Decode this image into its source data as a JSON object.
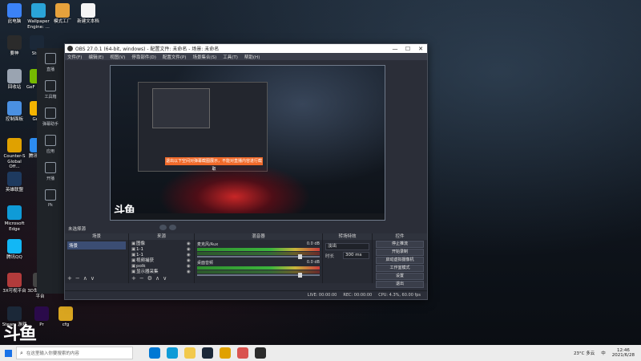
{
  "desktop": {
    "icons": [
      {
        "label": "此电脑",
        "color": "#3b82f6"
      },
      {
        "label": "Wallpaper Engine: ...",
        "color": "#2aa4d8"
      },
      {
        "label": "模式工厂",
        "color": "#e6a23c"
      },
      {
        "label": "新建文本档",
        "color": "#f5f5f5"
      },
      {
        "label": "要神",
        "color": "#2b2b2b"
      },
      {
        "label": "Stea",
        "color": "#1b2838"
      },
      {
        "label": "回收站",
        "color": "#9aa4b1"
      },
      {
        "label": "GeF Expe",
        "color": "#76b900"
      },
      {
        "label": "控制面板",
        "color": "#4a90e2"
      },
      {
        "label": "Goo",
        "color": "#f4b400"
      },
      {
        "label": "Counter-S Global Off...",
        "color": "#e0a100"
      },
      {
        "label": "腾讯 SD",
        "color": "#2d8cf0"
      },
      {
        "label": "英雄联盟",
        "color": "#1e3a5f"
      },
      {
        "label": "Microsoft Edge",
        "color": "#0f9bd7"
      },
      {
        "label": "腾讯QQ",
        "color": "#12b7f5"
      },
      {
        "label": "3X可视平台",
        "color": "#b23b3b"
      },
      {
        "label": "3D世界 观察平台",
        "color": "#444444"
      },
      {
        "label": "Steam 游戏",
        "color": "#1b2838"
      },
      {
        "label": "Pr",
        "color": "#2a0a4a"
      },
      {
        "label": "cfg",
        "color": "#d9a520"
      }
    ],
    "watermark": "斗鱼"
  },
  "background_app": {
    "items": [
      "直播",
      "工具箱",
      "弹幕助手",
      "应用",
      "开播",
      "Pk"
    ]
  },
  "obs": {
    "title": "OBS 27.0.1 (64-bit, windows) - 配置文件: 未命名 - 场景: 未命名",
    "menu": [
      "文件(F)",
      "编辑(E)",
      "视图(V)",
      "停靠部件(D)",
      "配置文件(P)",
      "场景集合(S)",
      "工具(T)",
      "帮助(H)"
    ],
    "preview_notice": "退出以下空间对弹幕截图展示，不能对直播内容进行截取",
    "scene_status": "未选择源",
    "docks": {
      "scenes": {
        "title": "场景",
        "items": [
          "场景"
        ]
      },
      "sources": {
        "title": "来源",
        "items": [
          "图像",
          "1-1",
          "1-1",
          "视频捕获",
          "polk",
          "显示器采集"
        ]
      },
      "mixer": {
        "title": "混音器",
        "channels": [
          {
            "name": "麦克风/Aux",
            "db": "0.0 dB"
          },
          {
            "name": "桌面音频",
            "db": "0.0 dB"
          }
        ]
      },
      "transitions": {
        "title": "转场特效",
        "type_label": "淡出",
        "duration_label": "时长",
        "duration_value": "300 ms"
      },
      "controls": {
        "title": "控件",
        "buttons": [
          "停止推流",
          "开始录制",
          "启动虚拟摄像机",
          "工作室模式",
          "设置",
          "退出"
        ]
      }
    },
    "statusbar": {
      "live": "LIVE: 00:00:00",
      "rec": "REC: 00:00:00",
      "cpu": "CPU: 4.3%, 60.00 fps"
    }
  },
  "taskbar": {
    "search_placeholder": "在这里输入你要搜索的内容",
    "weather": "23°C 多云",
    "ime": "中",
    "time": "12:46",
    "date": "2021/6/28"
  }
}
